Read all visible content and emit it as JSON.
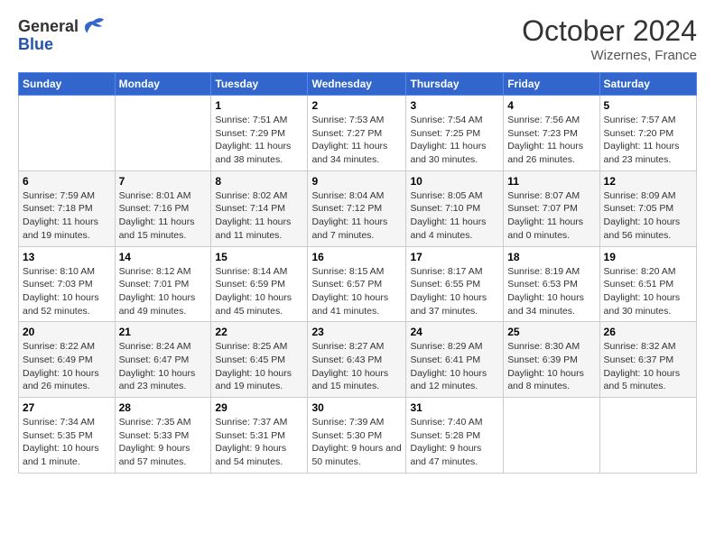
{
  "header": {
    "logo_general": "General",
    "logo_blue": "Blue",
    "month": "October 2024",
    "location": "Wizernes, France"
  },
  "days_of_week": [
    "Sunday",
    "Monday",
    "Tuesday",
    "Wednesday",
    "Thursday",
    "Friday",
    "Saturday"
  ],
  "weeks": [
    [
      {
        "day": "",
        "info": ""
      },
      {
        "day": "",
        "info": ""
      },
      {
        "day": "1",
        "info": "Sunrise: 7:51 AM\nSunset: 7:29 PM\nDaylight: 11 hours and 38 minutes."
      },
      {
        "day": "2",
        "info": "Sunrise: 7:53 AM\nSunset: 7:27 PM\nDaylight: 11 hours and 34 minutes."
      },
      {
        "day": "3",
        "info": "Sunrise: 7:54 AM\nSunset: 7:25 PM\nDaylight: 11 hours and 30 minutes."
      },
      {
        "day": "4",
        "info": "Sunrise: 7:56 AM\nSunset: 7:23 PM\nDaylight: 11 hours and 26 minutes."
      },
      {
        "day": "5",
        "info": "Sunrise: 7:57 AM\nSunset: 7:20 PM\nDaylight: 11 hours and 23 minutes."
      }
    ],
    [
      {
        "day": "6",
        "info": "Sunrise: 7:59 AM\nSunset: 7:18 PM\nDaylight: 11 hours and 19 minutes."
      },
      {
        "day": "7",
        "info": "Sunrise: 8:01 AM\nSunset: 7:16 PM\nDaylight: 11 hours and 15 minutes."
      },
      {
        "day": "8",
        "info": "Sunrise: 8:02 AM\nSunset: 7:14 PM\nDaylight: 11 hours and 11 minutes."
      },
      {
        "day": "9",
        "info": "Sunrise: 8:04 AM\nSunset: 7:12 PM\nDaylight: 11 hours and 7 minutes."
      },
      {
        "day": "10",
        "info": "Sunrise: 8:05 AM\nSunset: 7:10 PM\nDaylight: 11 hours and 4 minutes."
      },
      {
        "day": "11",
        "info": "Sunrise: 8:07 AM\nSunset: 7:07 PM\nDaylight: 11 hours and 0 minutes."
      },
      {
        "day": "12",
        "info": "Sunrise: 8:09 AM\nSunset: 7:05 PM\nDaylight: 10 hours and 56 minutes."
      }
    ],
    [
      {
        "day": "13",
        "info": "Sunrise: 8:10 AM\nSunset: 7:03 PM\nDaylight: 10 hours and 52 minutes."
      },
      {
        "day": "14",
        "info": "Sunrise: 8:12 AM\nSunset: 7:01 PM\nDaylight: 10 hours and 49 minutes."
      },
      {
        "day": "15",
        "info": "Sunrise: 8:14 AM\nSunset: 6:59 PM\nDaylight: 10 hours and 45 minutes."
      },
      {
        "day": "16",
        "info": "Sunrise: 8:15 AM\nSunset: 6:57 PM\nDaylight: 10 hours and 41 minutes."
      },
      {
        "day": "17",
        "info": "Sunrise: 8:17 AM\nSunset: 6:55 PM\nDaylight: 10 hours and 37 minutes."
      },
      {
        "day": "18",
        "info": "Sunrise: 8:19 AM\nSunset: 6:53 PM\nDaylight: 10 hours and 34 minutes."
      },
      {
        "day": "19",
        "info": "Sunrise: 8:20 AM\nSunset: 6:51 PM\nDaylight: 10 hours and 30 minutes."
      }
    ],
    [
      {
        "day": "20",
        "info": "Sunrise: 8:22 AM\nSunset: 6:49 PM\nDaylight: 10 hours and 26 minutes."
      },
      {
        "day": "21",
        "info": "Sunrise: 8:24 AM\nSunset: 6:47 PM\nDaylight: 10 hours and 23 minutes."
      },
      {
        "day": "22",
        "info": "Sunrise: 8:25 AM\nSunset: 6:45 PM\nDaylight: 10 hours and 19 minutes."
      },
      {
        "day": "23",
        "info": "Sunrise: 8:27 AM\nSunset: 6:43 PM\nDaylight: 10 hours and 15 minutes."
      },
      {
        "day": "24",
        "info": "Sunrise: 8:29 AM\nSunset: 6:41 PM\nDaylight: 10 hours and 12 minutes."
      },
      {
        "day": "25",
        "info": "Sunrise: 8:30 AM\nSunset: 6:39 PM\nDaylight: 10 hours and 8 minutes."
      },
      {
        "day": "26",
        "info": "Sunrise: 8:32 AM\nSunset: 6:37 PM\nDaylight: 10 hours and 5 minutes."
      }
    ],
    [
      {
        "day": "27",
        "info": "Sunrise: 7:34 AM\nSunset: 5:35 PM\nDaylight: 10 hours and 1 minute."
      },
      {
        "day": "28",
        "info": "Sunrise: 7:35 AM\nSunset: 5:33 PM\nDaylight: 9 hours and 57 minutes."
      },
      {
        "day": "29",
        "info": "Sunrise: 7:37 AM\nSunset: 5:31 PM\nDaylight: 9 hours and 54 minutes."
      },
      {
        "day": "30",
        "info": "Sunrise: 7:39 AM\nSunset: 5:30 PM\nDaylight: 9 hours and 50 minutes."
      },
      {
        "day": "31",
        "info": "Sunrise: 7:40 AM\nSunset: 5:28 PM\nDaylight: 9 hours and 47 minutes."
      },
      {
        "day": "",
        "info": ""
      },
      {
        "day": "",
        "info": ""
      }
    ]
  ]
}
